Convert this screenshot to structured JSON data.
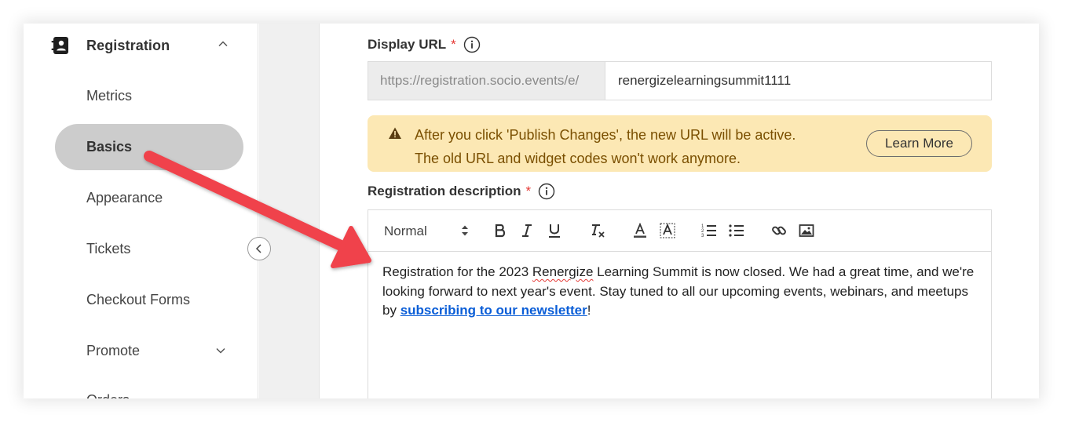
{
  "sidebar": {
    "section_title": "Registration",
    "items": [
      {
        "label": "Metrics"
      },
      {
        "label": "Basics",
        "active": true
      },
      {
        "label": "Appearance"
      },
      {
        "label": "Tickets"
      },
      {
        "label": "Checkout Forms"
      },
      {
        "label": "Promote"
      },
      {
        "label": "Orders"
      }
    ],
    "icons": {
      "section": "address-book-icon",
      "expand": "chevron-up-icon",
      "promote": "chevron-down-icon",
      "collapse": "chevron-left-icon"
    }
  },
  "display_url": {
    "label": "Display URL",
    "required_mark": "*",
    "prefix": "https://registration.socio.events/e/",
    "value": "renergizelearningsummit1111"
  },
  "alert": {
    "line1": "After you click 'Publish Changes', the new URL will be active.",
    "line2": "The old URL and widget codes won't work anymore.",
    "button": "Learn More",
    "icon": "warning-icon"
  },
  "description": {
    "label": "Registration description",
    "required_mark": "*",
    "toolbar": {
      "format": "Normal",
      "buttons": [
        "bold-icon",
        "italic-icon",
        "underline-icon",
        "clear-format-icon",
        "text-color-icon",
        "background-color-icon",
        "ordered-list-icon",
        "bullet-list-icon",
        "link-icon",
        "image-icon"
      ]
    },
    "text_before": "Registration for the 2023 ",
    "misspelled": "Renergize",
    "text_middle": " Learning Summit is now closed. We had a great time, and we're looking forward to next year's event. Stay tuned to all our upcoming events, webinars, and meetups by ",
    "link": "subscribing to our newsletter",
    "text_after": "!"
  },
  "colors": {
    "accent_alert_bg": "#fce8b4",
    "required": "#e53935",
    "link": "#0b5ed7",
    "arrow": "#f0424b",
    "active_item": "#cccccc"
  }
}
